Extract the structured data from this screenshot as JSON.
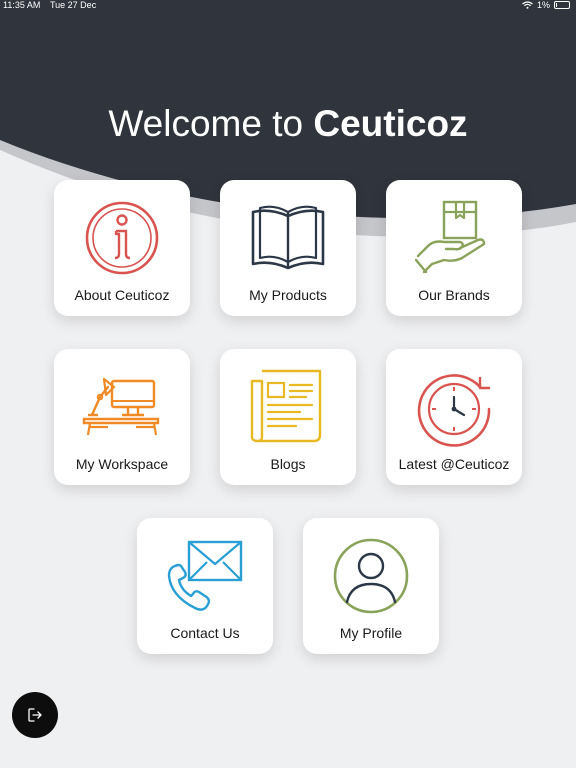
{
  "status_bar": {
    "time": "11:35 AM",
    "date": "Tue 27 Dec",
    "battery": "1%"
  },
  "welcome": {
    "prefix": "Welcome to ",
    "brand": "Ceuticoz"
  },
  "tiles": [
    {
      "label": "About Ceuticoz",
      "icon": "info-icon",
      "color": "#d9534f"
    },
    {
      "label": "My Products",
      "icon": "open-book-icon",
      "color": "#2c3848"
    },
    {
      "label": "Our Brands",
      "icon": "hand-box-icon",
      "color": "#8aa35a"
    },
    {
      "label": "My Workspace",
      "icon": "desk-lamp-icon",
      "color": "#f08a24"
    },
    {
      "label": "Blogs",
      "icon": "newspaper-icon",
      "color": "#e8b923"
    },
    {
      "label": "Latest @Ceuticoz",
      "icon": "clock-refresh-icon",
      "color": "#d9534f"
    },
    {
      "label": "Contact Us",
      "icon": "phone-envelope-icon",
      "color": "#2a9fd6"
    },
    {
      "label": "My Profile",
      "icon": "user-circle-icon",
      "color": "#8aa35a"
    }
  ],
  "colors": {
    "header": "#30343c",
    "header_shadow": "#c5c6c9",
    "background": "#eff0f2",
    "tile": "#ffffff",
    "logout": "#0d0d0d"
  },
  "logout": {
    "icon": "logout-icon"
  }
}
